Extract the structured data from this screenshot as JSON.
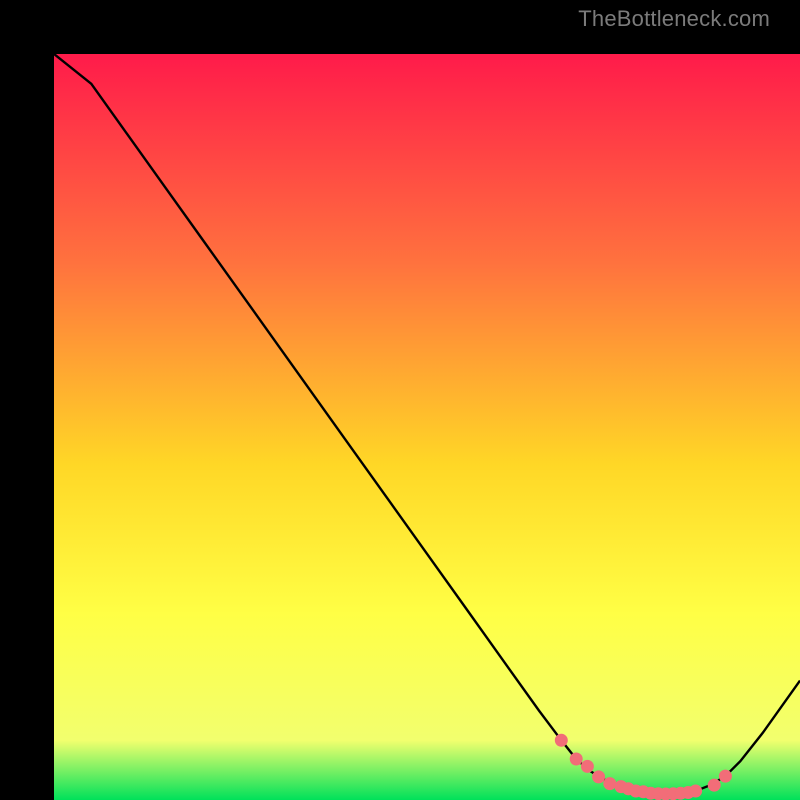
{
  "watermark": "TheBottleneck.com",
  "colors": {
    "bg": "#000000",
    "gradient_top": "#ff1b4a",
    "gradient_mid1": "#ff723e",
    "gradient_mid2": "#ffd726",
    "gradient_mid3": "#ffff45",
    "gradient_mid4": "#f2ff6e",
    "gradient_bottom": "#00e15a",
    "curve": "#000000",
    "marker_fill": "#f26d78",
    "marker_stroke": "#f26d78"
  },
  "chart_data": {
    "type": "line",
    "title": "",
    "xlabel": "",
    "ylabel": "",
    "xlim": [
      0,
      100
    ],
    "ylim": [
      0,
      100
    ],
    "series": [
      {
        "name": "curve",
        "x": [
          0,
          5,
          10,
          15,
          20,
          25,
          30,
          35,
          40,
          45,
          50,
          55,
          60,
          65,
          68,
          70,
          72,
          74,
          76,
          78,
          80,
          82,
          84,
          86,
          88,
          90,
          92,
          95,
          100
        ],
        "y": [
          100,
          96,
          89,
          82,
          75,
          68,
          61,
          54,
          47,
          40,
          33,
          26,
          19,
          12,
          8,
          5.5,
          3.8,
          2.6,
          1.8,
          1.2,
          0.9,
          0.8,
          0.9,
          1.2,
          2.0,
          3.2,
          5.2,
          9.0,
          16
        ]
      }
    ],
    "markers": {
      "name": "flat-region-dots",
      "x": [
        68,
        70,
        71.5,
        73,
        74.5,
        76,
        77,
        78,
        79,
        80,
        81,
        82,
        83,
        84,
        85,
        86,
        88.5,
        90
      ],
      "y": [
        8,
        5.5,
        4.5,
        3.1,
        2.2,
        1.8,
        1.5,
        1.2,
        1.1,
        0.9,
        0.85,
        0.8,
        0.85,
        0.9,
        1.0,
        1.2,
        2.0,
        3.2
      ]
    }
  }
}
